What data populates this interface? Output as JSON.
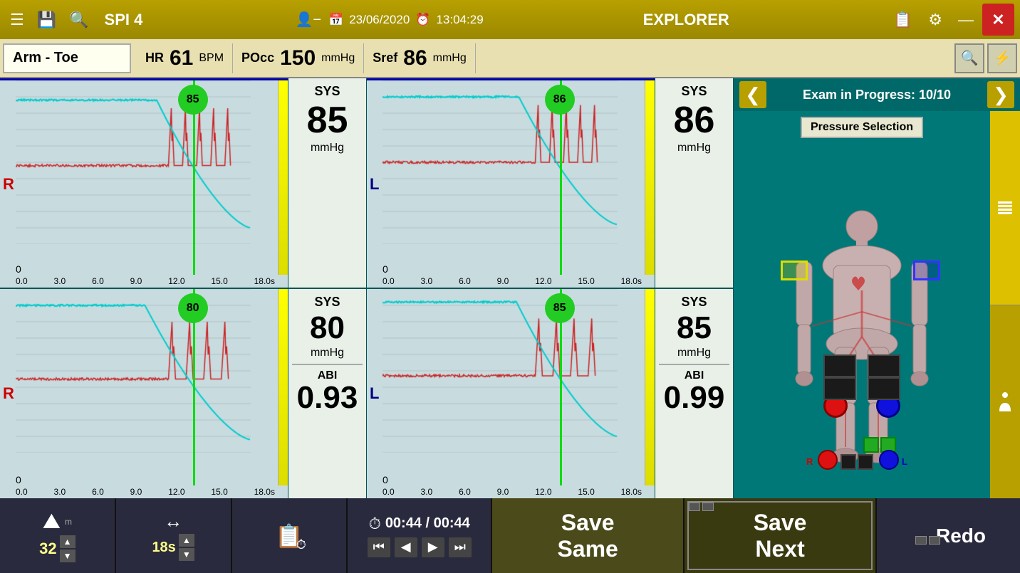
{
  "header": {
    "menu_icon": "☰",
    "save_icon": "💾",
    "search_icon": "🔍",
    "device": "SPI 4",
    "user_icon": "👤",
    "date_icon": "📅",
    "date": "23/06/2020",
    "clock_icon": "⏰",
    "time": "13:04:29",
    "app_title": "EXPLORER",
    "edit_icon": "📋",
    "settings_icon": "⚙",
    "minimize_icon": "—",
    "close_icon": "✕"
  },
  "vitals": {
    "location_label": "Arm - Toe",
    "hr_label": "HR",
    "hr_value": "61",
    "hr_unit": "BPM",
    "pocc_label": "POcc",
    "pocc_value": "150",
    "pocc_unit": "mmHg",
    "sref_label": "Sref",
    "sref_value": "86",
    "sref_unit": "mmHg"
  },
  "nav": {
    "prev_arrow": "❮",
    "next_arrow": "❯",
    "exam_progress": "Exam in Progress: 10/10"
  },
  "pressure_selection": {
    "label": "Pressure Selection"
  },
  "charts": {
    "top_right_bubble": "85",
    "top_left_bubble": "86",
    "bottom_right_bubble": "80",
    "bottom_left_bubble": "85",
    "y_max": "100",
    "y_min": "0",
    "x_labels": [
      "0.0",
      "3.0",
      "6.0",
      "9.0",
      "12.0",
      "15.0",
      "18.0s"
    ]
  },
  "sys_panels": {
    "top_right_sys": "85",
    "top_left_sys": "86",
    "bottom_right_sys": "80",
    "bottom_left_sys": "85",
    "bottom_right_abi": "0.93",
    "bottom_left_abi": "0.99",
    "sys_label": "SYS",
    "abi_label": "ABI",
    "mmhg": "mmHg"
  },
  "labels": {
    "r": "R",
    "l": "L"
  },
  "toolbar": {
    "amplitude_icon": "⛰",
    "amplitude_value": "32",
    "width_icon": "↔",
    "width_value": "18s",
    "clipboard_icon": "📋",
    "timer_icon": "⏱",
    "time_display": "00:44 / 00:44",
    "rewind": "⏮",
    "prev": "◀",
    "play": "▶",
    "fwd": "⏭",
    "save_same_label": "Save\nSame",
    "save_next_label": "Save\nNext",
    "redo_label": "Redo"
  }
}
